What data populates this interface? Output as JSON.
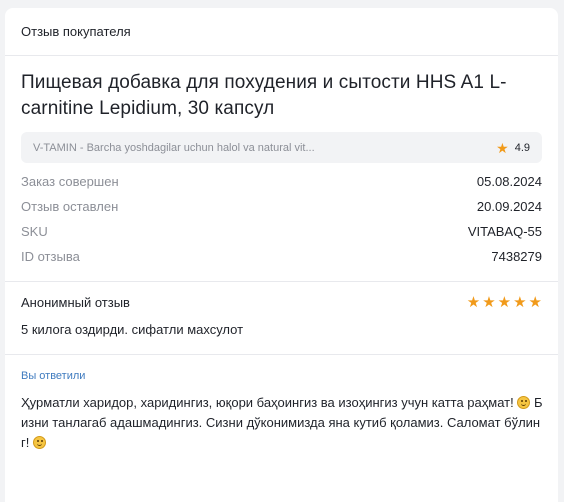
{
  "header": {
    "title": "Отзыв покупателя"
  },
  "product": {
    "title": "Пищевая добавка для похудения и сытости HHS A1 L-carnitine Lepidium, 30 капсул",
    "shop_name": "V-TAMIN - Barcha yoshdagilar uchun halol va natural vit...",
    "shop_rating": "4.9"
  },
  "meta": [
    {
      "label": "Заказ совершен",
      "value": "05.08.2024"
    },
    {
      "label": "Отзыв оставлен",
      "value": "20.09.2024"
    },
    {
      "label": "SKU",
      "value": "VITABAQ-55"
    },
    {
      "label": "ID отзыва",
      "value": "7438279"
    }
  ],
  "review": {
    "author": "Анонимный отзыв",
    "rating": 5,
    "text": "5 килога оздирди. сифатли махсулот"
  },
  "answer": {
    "label": "Вы ответили",
    "text_part1": "Ҳурматли харидор, харидингиз, юқори баҳоингиз ва изоҳингиз учун катта раҳмат! ",
    "text_part2": " Бизни танлагаб адашмадингиз. Сизни дўконимизда яна кутиб қоламиз. Саломат бўлинг! "
  },
  "colors": {
    "star": "#f19a1a",
    "accent_link": "#3f7bbf"
  },
  "icons": {
    "star": "star-icon",
    "emoji": "smiling-face-icon"
  }
}
